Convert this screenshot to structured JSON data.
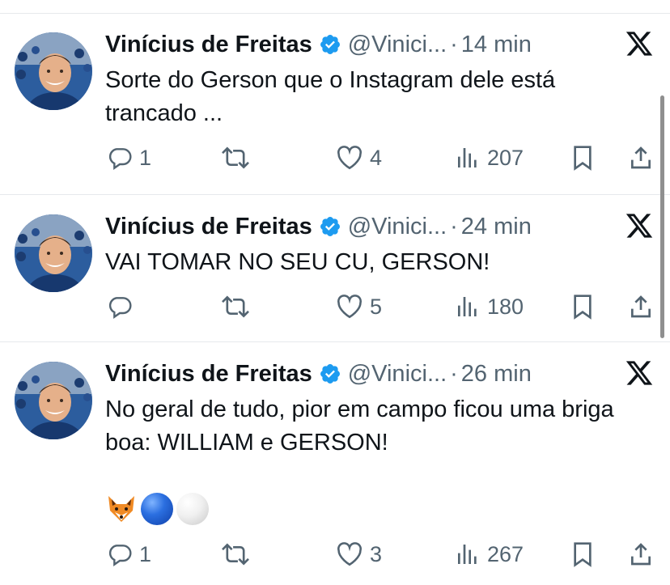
{
  "tweets": [
    {
      "author_name": "Vinícius de Freitas",
      "handle": "@Vinici...",
      "time": "14 min",
      "text": "Sorte do Gerson que o Instagram dele está trancado ...",
      "replies": "1",
      "retweets": "",
      "likes": "4",
      "views": "207"
    },
    {
      "author_name": "Vinícius de Freitas",
      "handle": "@Vinici...",
      "time": "24 min",
      "text": "VAI TOMAR NO SEU CU, GERSON!",
      "replies": "",
      "retweets": "",
      "likes": "5",
      "views": "180"
    },
    {
      "author_name": "Vinícius de Freitas",
      "handle": "@Vinici...",
      "time": "26 min",
      "text": "No geral de tudo, pior em campo ficou uma briga boa: WILLIAM e GERSON!",
      "emojis": [
        "fox",
        "blue-circle",
        "white-circle"
      ],
      "replies": "1",
      "retweets": "",
      "likes": "3",
      "views": "267"
    }
  ],
  "separator": "·",
  "colors": {
    "verified": "#1d9bf0",
    "muted": "#536471",
    "text": "#0f1419",
    "divider": "#e6e9ec"
  },
  "icons": [
    "reply-icon",
    "retweet-icon",
    "like-icon",
    "views-icon",
    "bookmark-icon",
    "share-icon",
    "x-logo-icon",
    "verified-badge-icon"
  ]
}
